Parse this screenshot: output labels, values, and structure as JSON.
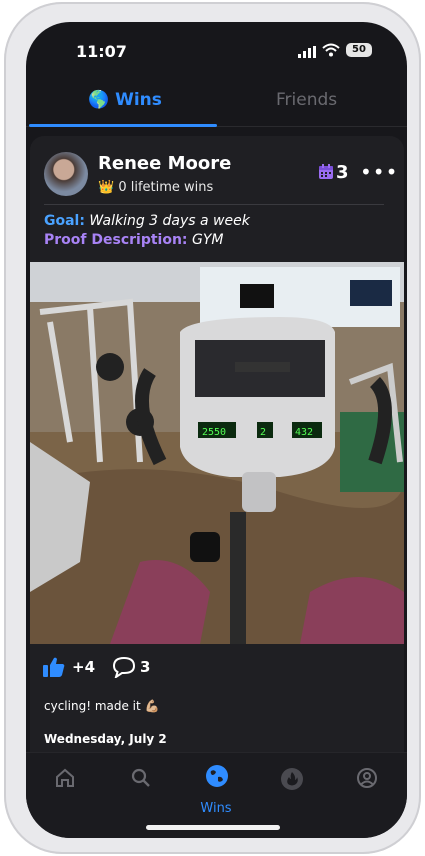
{
  "status_bar": {
    "time": "11:07",
    "battery": "50"
  },
  "tabs": [
    {
      "icon": "🌎",
      "label": "Wins",
      "active": true
    },
    {
      "label": "Friends",
      "active": false
    }
  ],
  "post": {
    "user_name": "Renee Moore",
    "crown": "👑",
    "lifetime_wins": "0 lifetime wins",
    "streak_count": "3",
    "more": "•••",
    "goal_label": "Goal:",
    "goal_value": "Walking 3 days a week",
    "proof_label": "Proof Description:",
    "proof_value": "GYM",
    "photo_screen_values": [
      "2550",
      "2",
      "432"
    ],
    "checks": [
      "done",
      "done",
      "pending"
    ],
    "likes": "+4",
    "comments": "3",
    "caption": "cycling! made it 💪🏼",
    "date": "Wednesday, July 2"
  },
  "nav": {
    "active_label": "Wins",
    "items": [
      "home-icon",
      "search-icon",
      "globe-icon",
      "fire-icon",
      "profile-icon"
    ]
  },
  "colors": {
    "accent": "#2f8cff",
    "goal": "#4aa2ff",
    "proof": "#a883f5",
    "check": "#3ad06a"
  }
}
